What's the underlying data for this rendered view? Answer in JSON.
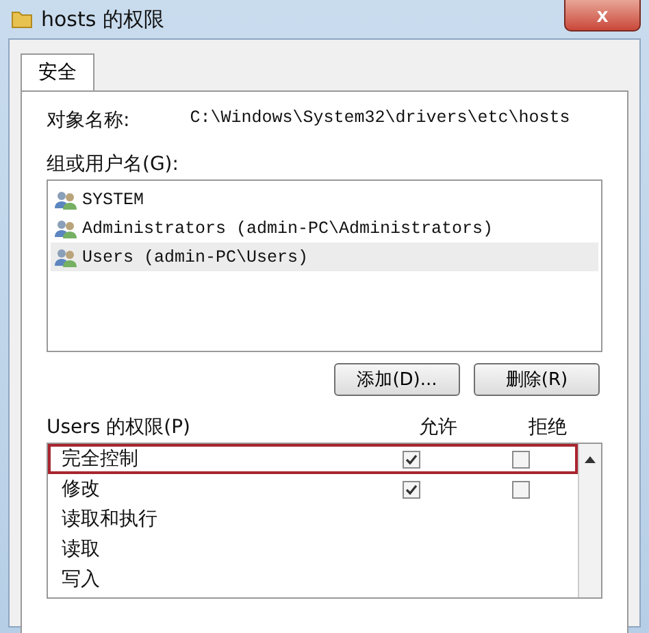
{
  "window": {
    "title": "hosts 的权限",
    "close": "x"
  },
  "tabs": [
    {
      "label": "安全",
      "selected": true
    }
  ],
  "object_name": {
    "label": "对象名称:",
    "value": "C:\\Windows\\System32\\drivers\\etc\\hosts"
  },
  "groups": {
    "label": "组或用户名(G):",
    "items": [
      {
        "name": "SYSTEM",
        "selected": false
      },
      {
        "name": "Administrators (admin-PC\\Administrators)",
        "selected": false
      },
      {
        "name": "Users (admin-PC\\Users)",
        "selected": true
      }
    ]
  },
  "buttons": [
    "添加(D)...",
    "删除(R)"
  ],
  "permissions": {
    "label": "Users 的权限(P)",
    "allow_label": "允许",
    "deny_label": "拒绝",
    "rows": [
      {
        "name": "完全控制",
        "highlighted": true,
        "allow": true,
        "deny": false
      },
      {
        "name": "修改",
        "highlighted": false,
        "allow": true,
        "deny": false
      },
      {
        "name": "读取和执行",
        "highlighted": false
      },
      {
        "name": "读取",
        "highlighted": false
      },
      {
        "name": "写入",
        "highlighted": false
      }
    ]
  }
}
